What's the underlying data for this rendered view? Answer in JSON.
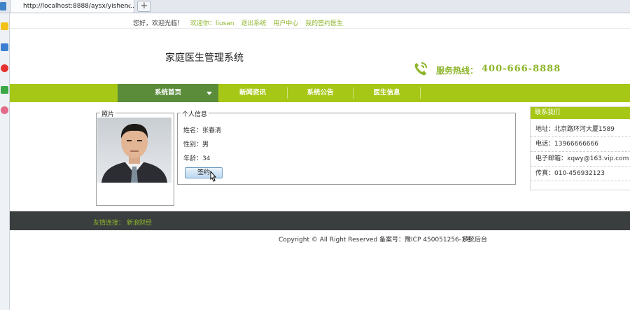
{
  "browser": {
    "tab_title": "http://localhost:8888/aysx/yishen...",
    "close_glyph": "×",
    "new_tab_glyph": "+"
  },
  "topbar": {
    "greeting": "您好，欢迎光临！",
    "welcome_user": "欢迎你：liusan",
    "logout": "退出系统",
    "user_center": "用户中心",
    "my_doctor": "我的签约医生"
  },
  "header": {
    "site_title": "家庭医生管理系统",
    "hotline_label": "服务热线：",
    "hotline_number": "400-666-8888"
  },
  "nav": {
    "items": [
      "系统首页",
      "新闻资讯",
      "系统公告",
      "医生信息"
    ],
    "active_index": 0
  },
  "photo_panel": {
    "legend": "照片"
  },
  "info_panel": {
    "legend": "个人信息",
    "name": "姓名：张春清",
    "gender": "性别：男",
    "age": "年龄：34",
    "sign_button": "签约"
  },
  "contact": {
    "title": "联系我们",
    "address": "地址：北京路环河大厦1589",
    "phone": "电话：13966666666",
    "email": "电子邮箱：xqwy@163.vip.com",
    "fax": "传真：010-456932123"
  },
  "footer": {
    "links_label": "友情连接：",
    "links": [
      "新浪财经"
    ],
    "copyright": "Copyright © All Right Reserved 备案号：豫ICP 450051256-1号",
    "admin": "系统后台"
  },
  "colors": {
    "accent": "#a6c716",
    "nav_active": "#5a8c3a",
    "link_green": "#8db52a",
    "footer_bg": "#3a3e3f"
  }
}
